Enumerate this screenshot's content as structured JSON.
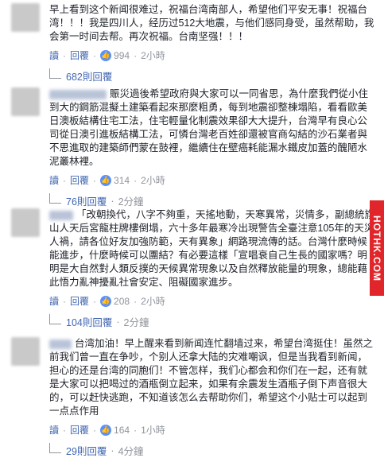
{
  "actions": {
    "reply_label": "回覆",
    "read_label": "讀",
    "dot": "·"
  },
  "comments": [
    {
      "text": "早上看到这个新闻很难过，祝福台湾南部人，希望他们平安无事！祝福台湾！！！我是四川人，经历过512大地震，与他们感同身受，虽然帮助，我会第一时间去帮。再次祝福。台南坚强！！！",
      "likes": "994",
      "time": "2小時",
      "replies": "682則回覆",
      "reply_time": ""
    },
    {
      "text": "賑災過後希望政府與大家可以一同省思，為什麼我們從小住到大的鋼筋混擬土建築看起來那麼粗勇，每到地震卻整棟塌陷，看看歐美日澳板結構住宅工法，住宅輕量化制震效果卻大大提升，台灣早有良心公司從日澳引進板結構工法，可憐台灣老百姓卻還被官商勾結的沙石業者與不思進取的建築師們蒙在鼓裡，繼續住在壁癌耗能漏水鐵皮加蓋的醜陋水泥叢林裡。",
      "likes": "314",
      "time": "2小時",
      "replies": "76則回覆",
      "reply_time": "2分鐘"
    },
    {
      "text": "「改朝換代，八字不夠重，天搖地動，天寒異常，災情多，副總統旗山人天后宮龍柱牌樓倒塌，六十多年最寒冷出現警告全臺注意105年的天災人禍，請各位好友加強防範，天有異象」網路現流傳的話。台灣什麼時候能進步，什麼時候可以團結？有必要這樣「宣唱衰自己生長的國家嗎？明明是大自然對人類反撲的天候異常現象以及自然釋放能量的現象，總能藉此悟力亂神擾亂社會安定、阻礙國家進步。",
      "likes": "208",
      "time": "2小時",
      "replies": "104則回覆",
      "reply_time": "2分鐘"
    },
    {
      "text": "台湾加油！早上醒来看到新闻连忙翻墙过来，希望台湾挺住！虽然之前我们曾一直在争吵，个别人还拿大陆的灾难嘲讽，但是当我看到新闻，担心的还是台湾的同胞们！不管怎样，我们心都会和你们在一起，还有就是大家可以把喝过的酒瓶倒立起来，如果有余震发生酒瓶子倒下声音很大的，可以赶快逃跑，不知道该怎么去帮助你们，希望这个小贴士可以起到一点点作用",
      "likes": "164",
      "time": "1小時",
      "replies": "29則回覆",
      "reply_time": "4分鐘"
    }
  ],
  "watermark": "HOTHK.COM"
}
